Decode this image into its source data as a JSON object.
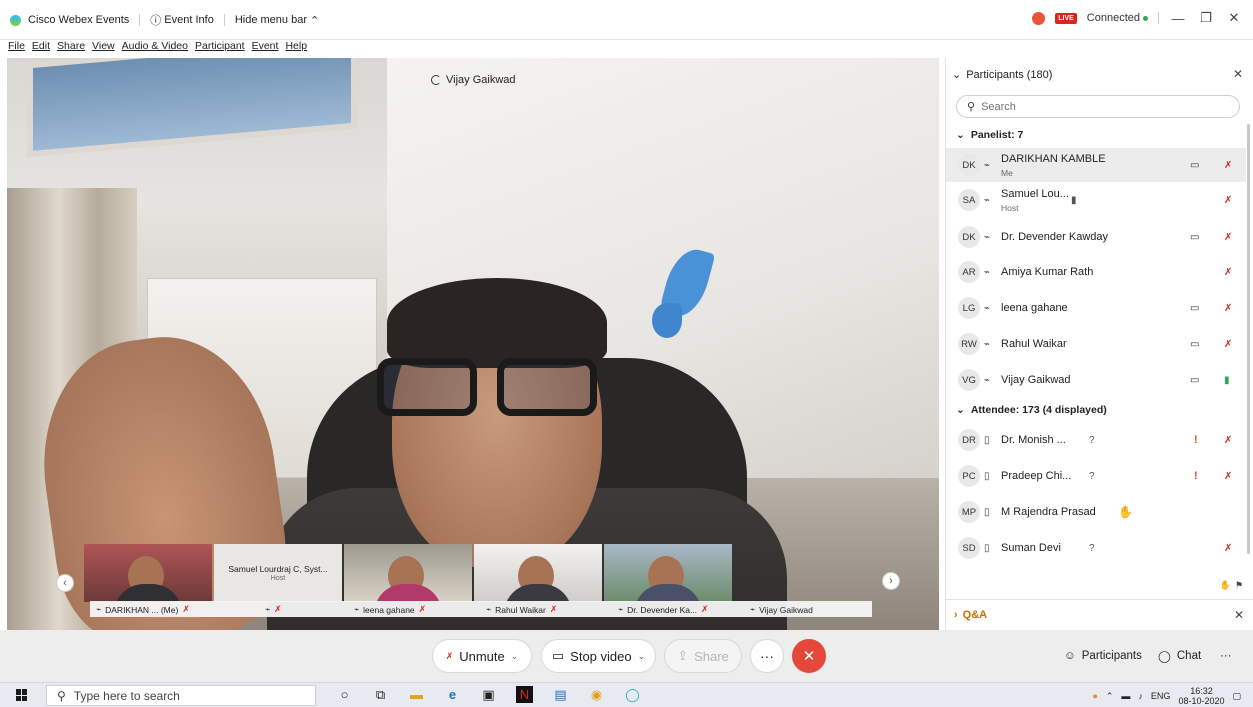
{
  "window": {
    "app_title": "Cisco Webex Events",
    "event_info": "Event Info",
    "hide_menu": "Hide menu bar",
    "status": "Connected",
    "live": "LIVE"
  },
  "menu": [
    "File",
    "Edit",
    "Share",
    "View",
    "Audio & Video",
    "Participant",
    "Event",
    "Help"
  ],
  "video": {
    "active_speaker": "Vijay Gaikwad"
  },
  "filmstrip": {
    "host_tile_name": "Samuel Lourdraj C, Syst...",
    "host_tile_role": "Host",
    "names": [
      "DARIKHAN ... (Me)",
      "leena gahane",
      "Rahul Waikar",
      "Dr. Devender Ka...",
      "Vijay Gaikwad"
    ]
  },
  "controls": {
    "unmute": "Unmute",
    "stop_video": "Stop video",
    "share": "Share",
    "more": "···",
    "leave": "✕",
    "participants": "Participants",
    "chat": "Chat",
    "overflow": "···"
  },
  "panel": {
    "title": "Participants (180)",
    "search_placeholder": "Search",
    "panelist_header": "Panelist: 7",
    "attendee_header": "Attendee: 173 (4 displayed)",
    "qa_label": "Q&A",
    "panelists": [
      {
        "initials": "DK",
        "name": "DARIKHAN KAMBLE",
        "sub": "Me"
      },
      {
        "initials": "SA",
        "name": "Samuel Lou...",
        "sub": "Host"
      },
      {
        "initials": "DK",
        "name": "Dr. Devender Kawday",
        "sub": ""
      },
      {
        "initials": "AR",
        "name": "Amiya Kumar Rath",
        "sub": ""
      },
      {
        "initials": "LG",
        "name": "leena gahane",
        "sub": ""
      },
      {
        "initials": "RW",
        "name": "Rahul Waikar",
        "sub": ""
      },
      {
        "initials": "VG",
        "name": "Vijay Gaikwad",
        "sub": ""
      }
    ],
    "attendees": [
      {
        "initials": "DR",
        "name": "Dr. Monish ...",
        "flag": "?"
      },
      {
        "initials": "PC",
        "name": "Pradeep Chi...",
        "flag": "?"
      },
      {
        "initials": "MP",
        "name": "M Rajendra Prasad",
        "flag": ""
      },
      {
        "initials": "SD",
        "name": "Suman Devi",
        "flag": "?"
      }
    ]
  },
  "taskbar": {
    "search_placeholder": "Type here to search",
    "lang": "ENG",
    "time": "16:32",
    "date": "08-10-2020"
  }
}
